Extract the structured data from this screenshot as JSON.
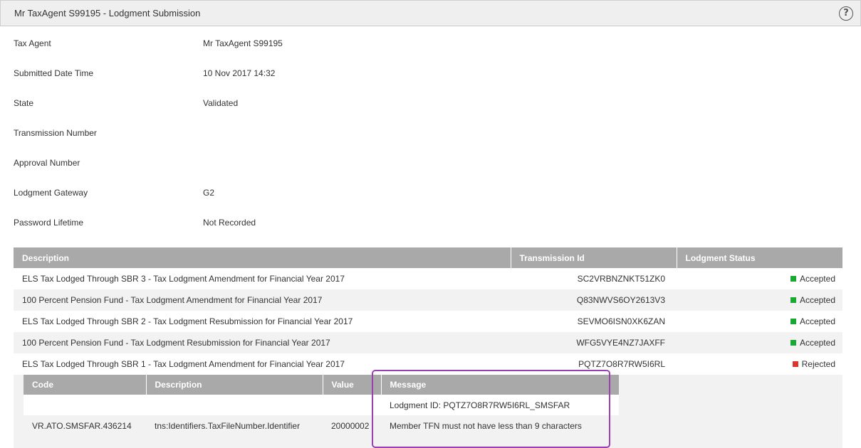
{
  "header": {
    "title": "Mr TaxAgent S99195 - Lodgment Submission",
    "help_icon": "question-circle-icon"
  },
  "fields": [
    {
      "label": "Tax Agent",
      "value": "Mr TaxAgent S99195"
    },
    {
      "label": "Submitted Date Time",
      "value": "10 Nov 2017 14:32"
    },
    {
      "label": "State",
      "value": "Validated"
    },
    {
      "label": "Transmission Number",
      "value": ""
    },
    {
      "label": "Approval Number",
      "value": ""
    },
    {
      "label": "Lodgment Gateway",
      "value": "G2"
    },
    {
      "label": "Password Lifetime",
      "value": "Not Recorded"
    }
  ],
  "lodgments": {
    "columns": [
      "Description",
      "Transmission Id",
      "Lodgment Status"
    ],
    "rows": [
      {
        "description": "ELS Tax Lodged Through SBR 3 - Tax Lodgment Amendment for Financial Year 2017",
        "transmission_id": "SC2VRBNZNKT51ZK0",
        "status": "Accepted",
        "status_color": "#1aa832"
      },
      {
        "description": "100 Percent Pension Fund - Tax Lodgment Amendment for Financial Year 2017",
        "transmission_id": "Q83NWVS6OY2613V3",
        "status": "Accepted",
        "status_color": "#1aa832"
      },
      {
        "description": "ELS Tax Lodged Through SBR 2 - Tax Lodgment Resubmission for Financial Year 2017",
        "transmission_id": "SEVMO6ISN0XK6ZAN",
        "status": "Accepted",
        "status_color": "#1aa832"
      },
      {
        "description": "100 Percent Pension Fund - Tax Lodgment Resubmission for Financial Year 2017",
        "transmission_id": "WFG5VYE4NZ7JAXFF",
        "status": "Accepted",
        "status_color": "#1aa832"
      },
      {
        "description": "ELS Tax Lodged Through SBR 1 - Tax Lodgment Amendment for Financial Year 2017",
        "transmission_id": "PQTZ7O8R7RW5I6RL",
        "status": "Rejected",
        "status_color": "#e2312f"
      }
    ]
  },
  "errors": {
    "columns": [
      "Code",
      "Description",
      "Value",
      "Message"
    ],
    "rows": [
      {
        "code": "",
        "description": "",
        "value": "",
        "message": "Lodgment ID: PQTZ7O8R7RW5I6RL_SMSFAR"
      },
      {
        "code": "VR.ATO.SMSFAR.436214",
        "description": "tns:Identifiers.TaxFileNumber.Identifier",
        "value": "20000002",
        "message": "Member TFN must not have less than 9 characters"
      }
    ]
  },
  "colors": {
    "accepted": "#1aa832",
    "rejected": "#e2312f",
    "highlight": "#9b3fb5",
    "table_header": "#a9a9a9"
  }
}
